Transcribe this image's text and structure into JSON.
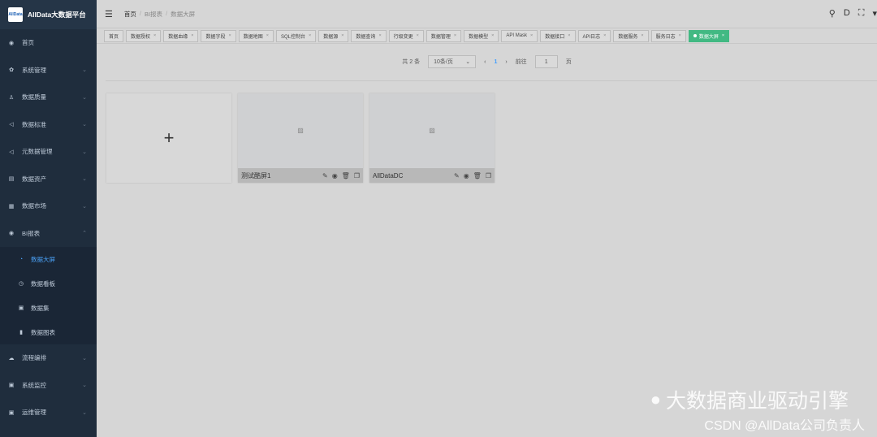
{
  "app": {
    "title": "AllData大数据平台",
    "logo_text": "AllData"
  },
  "sidebar": {
    "items": [
      {
        "label": "首页",
        "icon": "dashboard-icon",
        "glyph": "◉"
      },
      {
        "label": "系统管理",
        "icon": "gear-icon",
        "glyph": "✿"
      },
      {
        "label": "数据质量",
        "icon": "user-icon",
        "glyph": "♙"
      },
      {
        "label": "数据标准",
        "icon": "send-icon",
        "glyph": "◁"
      },
      {
        "label": "元数据管理",
        "icon": "send-icon",
        "glyph": "◁"
      },
      {
        "label": "数据资产",
        "icon": "document-icon",
        "glyph": "▤"
      },
      {
        "label": "数据市场",
        "icon": "table-icon",
        "glyph": "▦"
      },
      {
        "label": "BI报表",
        "icon": "bi-icon",
        "glyph": "◉"
      }
    ],
    "bi_sub": [
      {
        "label": "数据大屏",
        "icon": "screen-icon",
        "glyph": "◔"
      },
      {
        "label": "数据看板",
        "icon": "clock-icon",
        "glyph": "◷"
      },
      {
        "label": "数据集",
        "icon": "dataset-icon",
        "glyph": "▣"
      },
      {
        "label": "数据图表",
        "icon": "bar-chart-icon",
        "glyph": "▮"
      }
    ],
    "bottom": [
      {
        "label": "流程编排",
        "icon": "cloud-icon",
        "glyph": "☁"
      },
      {
        "label": "系统监控",
        "icon": "monitor-icon",
        "glyph": "▣"
      },
      {
        "label": "运维管理",
        "icon": "ops-icon",
        "glyph": "▣"
      }
    ]
  },
  "breadcrumb": {
    "home": "首页",
    "bi": "BI报表",
    "current": "数据大屏"
  },
  "tags": [
    "首页",
    "数据授权",
    "数据血缘",
    "数据字段",
    "数据地图",
    "SQL控制台",
    "数据源",
    "数据查询",
    "行级变更",
    "数据管理",
    "数据模型",
    "API Mask",
    "数据接口",
    "API日志",
    "数据服务",
    "服务日志"
  ],
  "active_tag": "数据大屏",
  "pager": {
    "total": "共 2 条",
    "page_size": "10条/页",
    "current": "1",
    "goto": "前往",
    "goto_value": "1",
    "page_unit": "页"
  },
  "cards": [
    {
      "name": "测试酷屏1"
    },
    {
      "name": "AllDataDC"
    }
  ],
  "watermark": {
    "line1": "大数据商业驱动引擎",
    "line2": "CSDN @AllData公司负责人"
  }
}
